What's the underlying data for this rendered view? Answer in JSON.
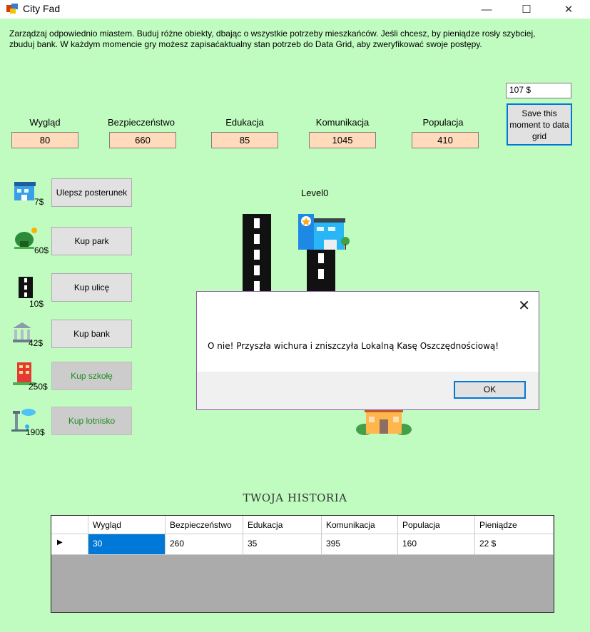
{
  "window": {
    "title": "City Fad",
    "minimize": "—",
    "maximize": "☐",
    "close": "✕"
  },
  "description": "Zarządzaj odpowiednio miastem. Buduj różne obiekty, dbając o wszystkie potrzeby mieszkańców. Jeśli chcesz, by pieniądze rosły szybciej, zbuduj bank. W każdym momencie gry możesz zapisaćaktualny stan potrzeb do Data Grid, aby zweryfikować swoje postępy.",
  "money": "107 $",
  "save_button": "Save this moment to data grid",
  "stats": [
    {
      "label": "Wygląd",
      "value": "80"
    },
    {
      "label": "Bezpieczeństwo",
      "value": "660"
    },
    {
      "label": "Edukacja",
      "value": "85"
    },
    {
      "label": "Komunikacja",
      "value": "1045"
    },
    {
      "label": "Populacja",
      "value": "410"
    }
  ],
  "actions": [
    {
      "label": "Ulepsz posterunek",
      "price": "7$",
      "icon": "police-station-icon",
      "enabled": true
    },
    {
      "label": "Kup park",
      "price": "60$",
      "icon": "park-icon",
      "enabled": true
    },
    {
      "label": "Kup ulicę",
      "price": "10$",
      "icon": "street-icon",
      "enabled": true
    },
    {
      "label": "Kup bank",
      "price": "42$",
      "icon": "bank-icon",
      "enabled": true
    },
    {
      "label": "Kup szkołę",
      "price": "250$",
      "icon": "school-icon",
      "enabled": false
    },
    {
      "label": "Kup lotnisko",
      "price": "190$",
      "icon": "airport-icon",
      "enabled": false
    }
  ],
  "level": "Level0",
  "dialog": {
    "message": "O nie! Przyszła wichura i zniszczyła Lokalną Kasę Oszczędnościową!",
    "ok": "OK",
    "close": "✕"
  },
  "history_title": "TWOJA HISTORIA",
  "grid": {
    "columns": [
      "Wygląd",
      "Bezpieczeństwo",
      "Edukacja",
      "Komunikacja",
      "Populacja",
      "Pieniądze"
    ],
    "rows": [
      [
        "30",
        "260",
        "35",
        "395",
        "160",
        "22 $"
      ]
    ],
    "row_marker": "▶"
  },
  "colors": {
    "background": "#c0fcc0",
    "stat_box": "#ffdabb",
    "accent": "#0078d7",
    "disabled_text": "#1e8c1e"
  }
}
